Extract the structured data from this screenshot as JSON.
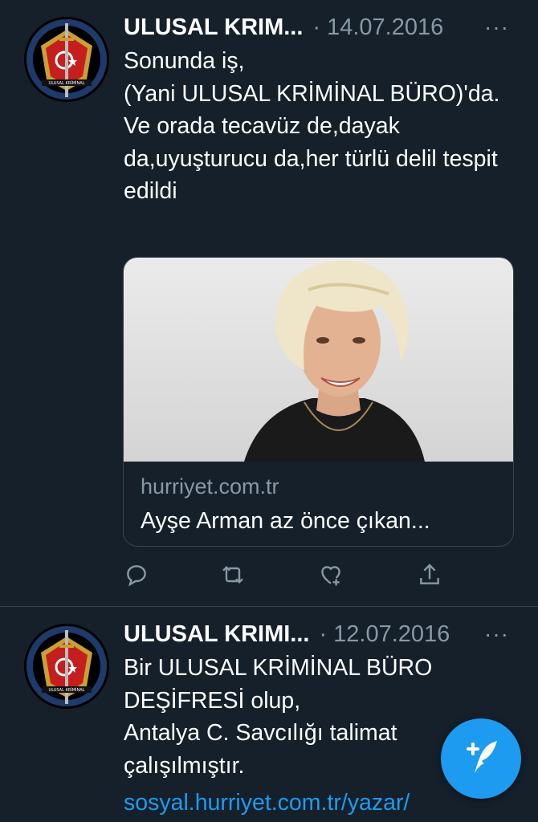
{
  "tweets": [
    {
      "name": "ULUSAL KRIM...",
      "separator": "·",
      "date": "14.07.2016",
      "more": "···",
      "text": "Sonunda iş,\n(Yani ULUSAL KRİMİNAL BÜRO)'da.\nVe orada tecavüz de,dayak da,uyuşturucu da,her türlü delil tespit edildi",
      "card": {
        "domain": "hurriyet.com.tr",
        "title": "Ayşe Arman az önce çıkan..."
      },
      "actions": [
        "reply-icon",
        "retweet-icon",
        "like-icon",
        "share-icon"
      ]
    },
    {
      "name": "ULUSAL KRIMI...",
      "separator": "·",
      "date": "12.07.2016",
      "more": "···",
      "text": "Bir ULUSAL KRİMİNAL BÜRO DEŞİFRESİ olup,\nAntalya C. Savcılığı talimat\nçalışılmıştır.",
      "link": "sosyal.hurriyet.com.tr/yazar/"
    }
  ],
  "avatar_label": "ULUSAL KRİMİNAL",
  "compose_icon": "feather-plus-icon",
  "colors": {
    "background": "#15202b",
    "muted": "#8899a6",
    "accent": "#1d9bf0",
    "border": "#38444d"
  }
}
